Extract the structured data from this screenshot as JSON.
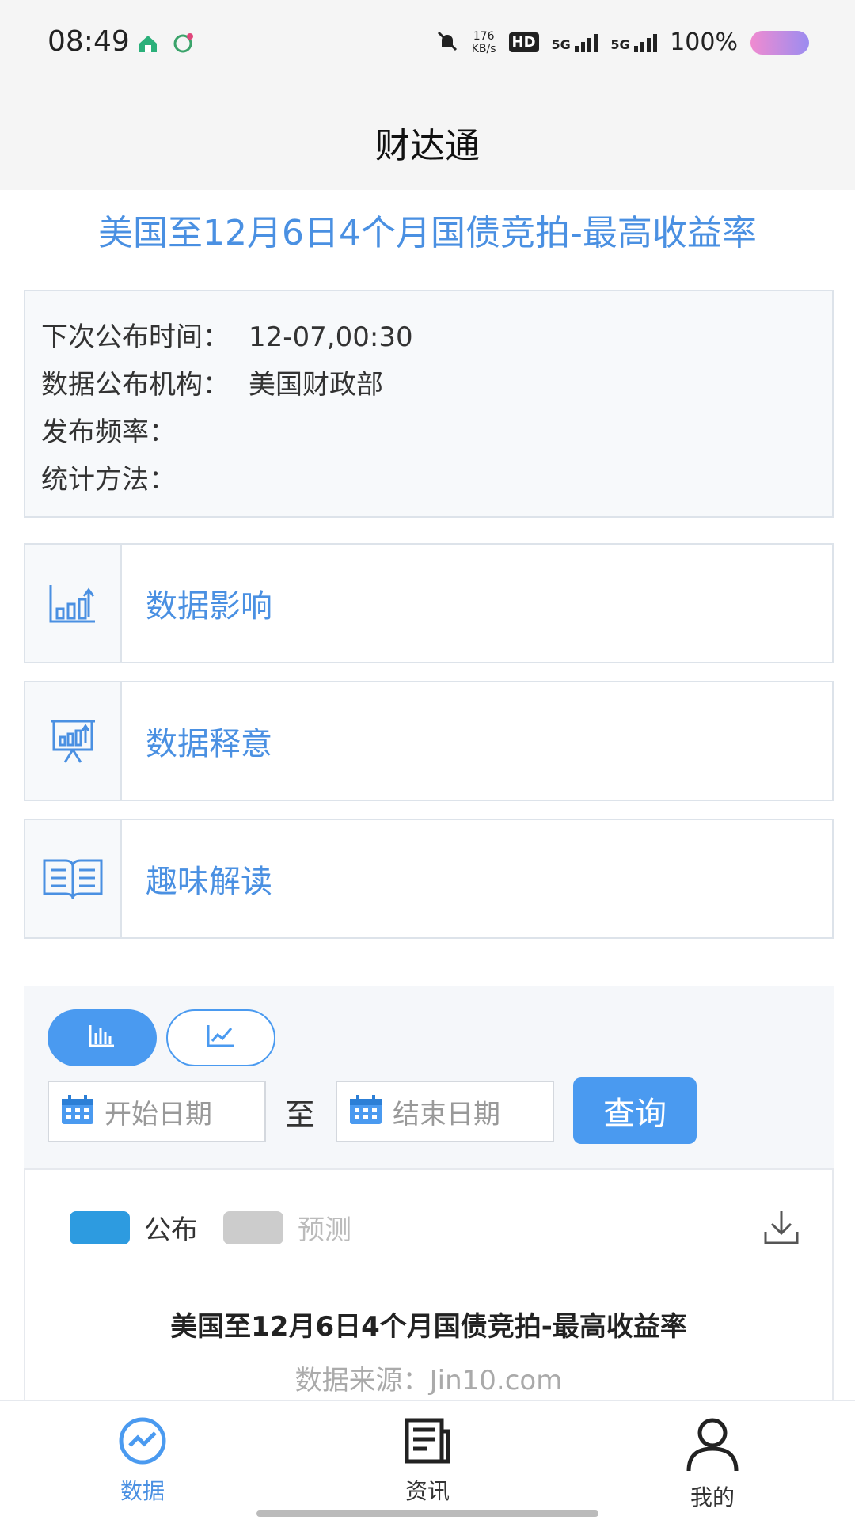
{
  "status_bar": {
    "time": "08:49",
    "net_speed_value": "176",
    "net_speed_unit": "KB/s",
    "hd": "HD",
    "sig1": "5G",
    "sig2": "5G",
    "battery": "100%"
  },
  "header": {
    "title": "财达通"
  },
  "page": {
    "title": "美国至12月6日4个月国债竞拍-最高收益率"
  },
  "info": {
    "rows": [
      {
        "label": "下次公布时间：",
        "value": "12-07,00:30"
      },
      {
        "label": "数据公布机构：",
        "value": "美国财政部"
      },
      {
        "label": "发布频率：",
        "value": ""
      },
      {
        "label": "统计方法：",
        "value": ""
      }
    ]
  },
  "menu": {
    "items": [
      {
        "label": "数据影响",
        "icon": "bar-chart-up-icon"
      },
      {
        "label": "数据释意",
        "icon": "presentation-board-icon"
      },
      {
        "label": "趣味解读",
        "icon": "open-book-icon"
      }
    ]
  },
  "query": {
    "start_placeholder": "开始日期",
    "end_placeholder": "结束日期",
    "separator": "至",
    "button": "查询"
  },
  "chart": {
    "legend": [
      {
        "label": "公布",
        "color": "#2d9be0"
      },
      {
        "label": "预测",
        "color": "#cccccc"
      }
    ],
    "title": "美国至12月6日4个月国债竞拍-最高收益率",
    "source": "数据来源：Jin10.com"
  },
  "nav": {
    "items": [
      {
        "label": "数据",
        "icon": "chart-circle-icon"
      },
      {
        "label": "资讯",
        "icon": "news-icon"
      },
      {
        "label": "我的",
        "icon": "person-icon"
      }
    ]
  },
  "colors": {
    "accent": "#4a90e2",
    "button": "#4a9af0"
  }
}
